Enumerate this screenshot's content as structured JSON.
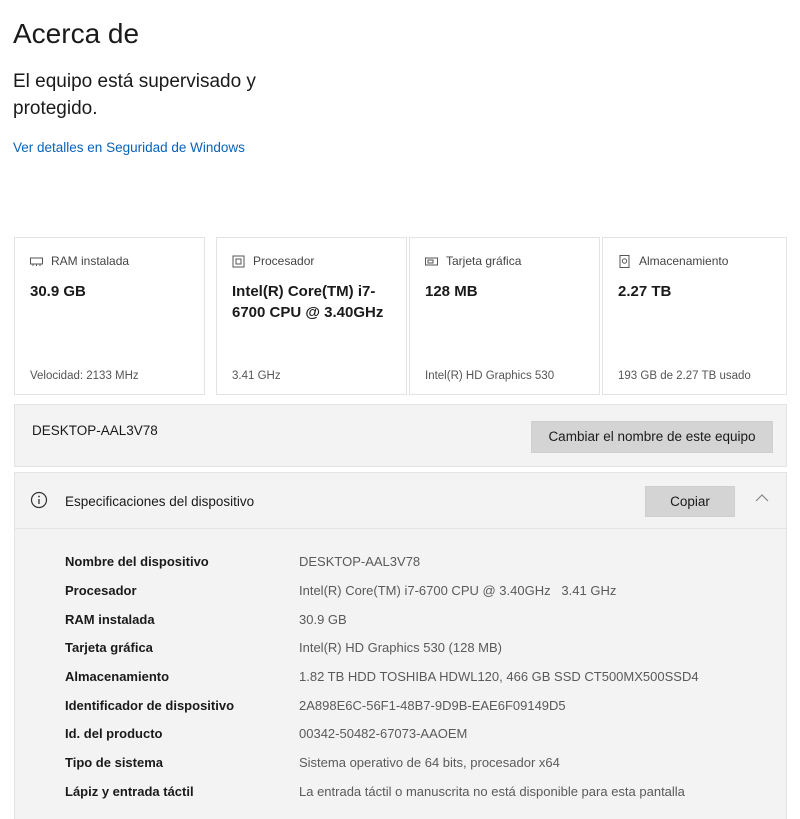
{
  "page": {
    "title": "Acerca de",
    "status": "El equipo está supervisado y protegido.",
    "security_link": "Ver detalles en Seguridad de Windows"
  },
  "cards": [
    {
      "icon": "memory-icon",
      "label": "RAM instalada",
      "value": "30.9 GB",
      "footer": "Velocidad: 2133 MHz"
    },
    {
      "icon": "processor-icon",
      "label": "Procesador",
      "value": "Intel(R) Core(TM) i7-6700 CPU @ 3.40GHz",
      "footer": "3.41 GHz"
    },
    {
      "icon": "graphics-card-icon",
      "label": "Tarjeta gráfica",
      "value": "128 MB",
      "footer": "Intel(R) HD Graphics 530"
    },
    {
      "icon": "storage-icon",
      "label": "Almacenamiento",
      "value": "2.27 TB",
      "footer": "193 GB de 2.27 TB usado"
    }
  ],
  "device": {
    "name": "DESKTOP-AAL3V78",
    "rename_button": "Cambiar el nombre de este equipo"
  },
  "specs": {
    "header": "Especificaciones del dispositivo",
    "copy_button": "Copiar",
    "rows": [
      {
        "key": "Nombre del dispositivo",
        "value": "DESKTOP-AAL3V78"
      },
      {
        "key": "Procesador",
        "value": "Intel(R) Core(TM) i7-6700 CPU @ 3.40GHz   3.41 GHz"
      },
      {
        "key": "RAM instalada",
        "value": "30.9 GB"
      },
      {
        "key": "Tarjeta gráfica",
        "value": "Intel(R) HD Graphics 530 (128 MB)"
      },
      {
        "key": "Almacenamiento",
        "value": "1.82 TB HDD TOSHIBA HDWL120, 466 GB SSD CT500MX500SSD4"
      },
      {
        "key": "Identificador de dispositivo",
        "value": "2A898E6C-56F1-48B7-9D9B-EAE6F09149D5"
      },
      {
        "key": "Id. del producto",
        "value": "00342-50482-67073-AAOEM"
      },
      {
        "key": "Tipo de sistema",
        "value": "Sistema operativo de 64 bits, procesador x64"
      },
      {
        "key": "Lápiz y entrada táctil",
        "value": "La entrada táctil o manuscrita no está disponible para esta pantalla"
      }
    ]
  },
  "colors": {
    "accent_link": "#0a62b8",
    "panel_bg": "#f3f3f3",
    "button_bg": "#d4d4d4"
  }
}
